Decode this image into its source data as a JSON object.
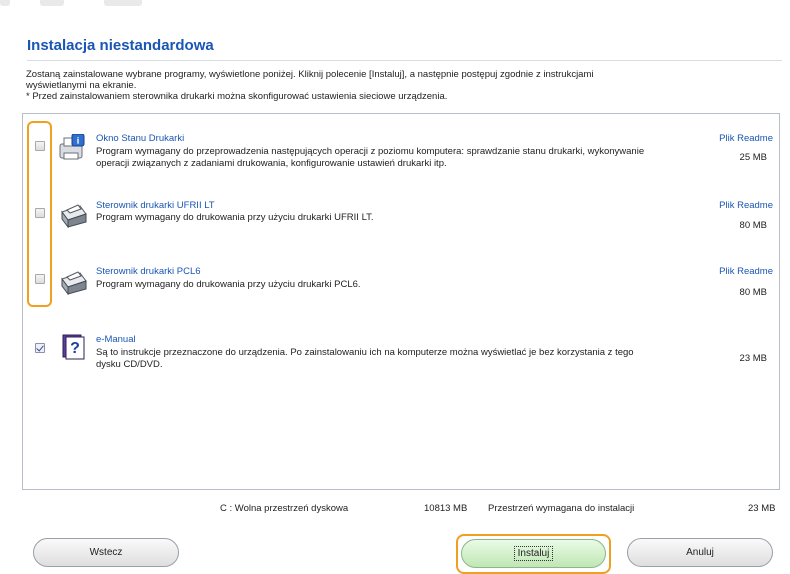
{
  "title": "Instalacja niestandardowa",
  "intro_line1": "Zostaną zainstalowane wybrane programy, wyświetlone poniżej. Kliknij polecenie [Instaluj], a następnie postępuj zgodnie z instrukcjami",
  "intro_line2": "wyświetlanymi na ekranie.",
  "intro_note": "* Przed zainstalowaniem sterownika drukarki można skonfigurować ustawienia sieciowe urządzenia.",
  "items": [
    {
      "name": "Okno Stanu Drukarki",
      "desc": "Program wymagany do przeprowadzenia następujących operacji z poziomu komputera: sprawdzanie stanu drukarki, wykonywanie operacji związanych z zadaniami drukowania, konfigurowanie ustawień drukarki itp.",
      "readme": "Plik Readme",
      "size": "25 MB",
      "checked": false,
      "icon": "printer-status-icon"
    },
    {
      "name": "Sterownik drukarki UFRII LT",
      "desc": "Program wymagany do drukowania przy użyciu drukarki UFRII LT.",
      "readme": "Plik Readme",
      "size": "80 MB",
      "checked": false,
      "icon": "printer-icon"
    },
    {
      "name": "Sterownik drukarki PCL6",
      "desc": "Program wymagany do drukowania przy użyciu drukarki PCL6.",
      "readme": "Plik Readme",
      "size": "80 MB",
      "checked": false,
      "icon": "printer-icon"
    },
    {
      "name": "e-Manual",
      "desc": "Są to instrukcje przeznaczone do urządzenia. Po zainstalowaniu ich na komputerze można wyświetlać je bez korzystania z tego dysku CD/DVD.",
      "readme": "",
      "size": "23 MB",
      "checked": true,
      "icon": "help-book-icon"
    }
  ],
  "disk": {
    "free_label": "C : Wolna przestrzeń dyskowa",
    "free_value": "10813 MB",
    "required_label": "Przestrzeń wymagana do instalacji",
    "required_value": "23 MB"
  },
  "buttons": {
    "back": "Wstecz",
    "install": "Instaluj",
    "cancel": "Anuluj"
  },
  "colors": {
    "link": "#1a56b3",
    "highlight": "#f0a020",
    "install_button": "#c8ecc0"
  }
}
